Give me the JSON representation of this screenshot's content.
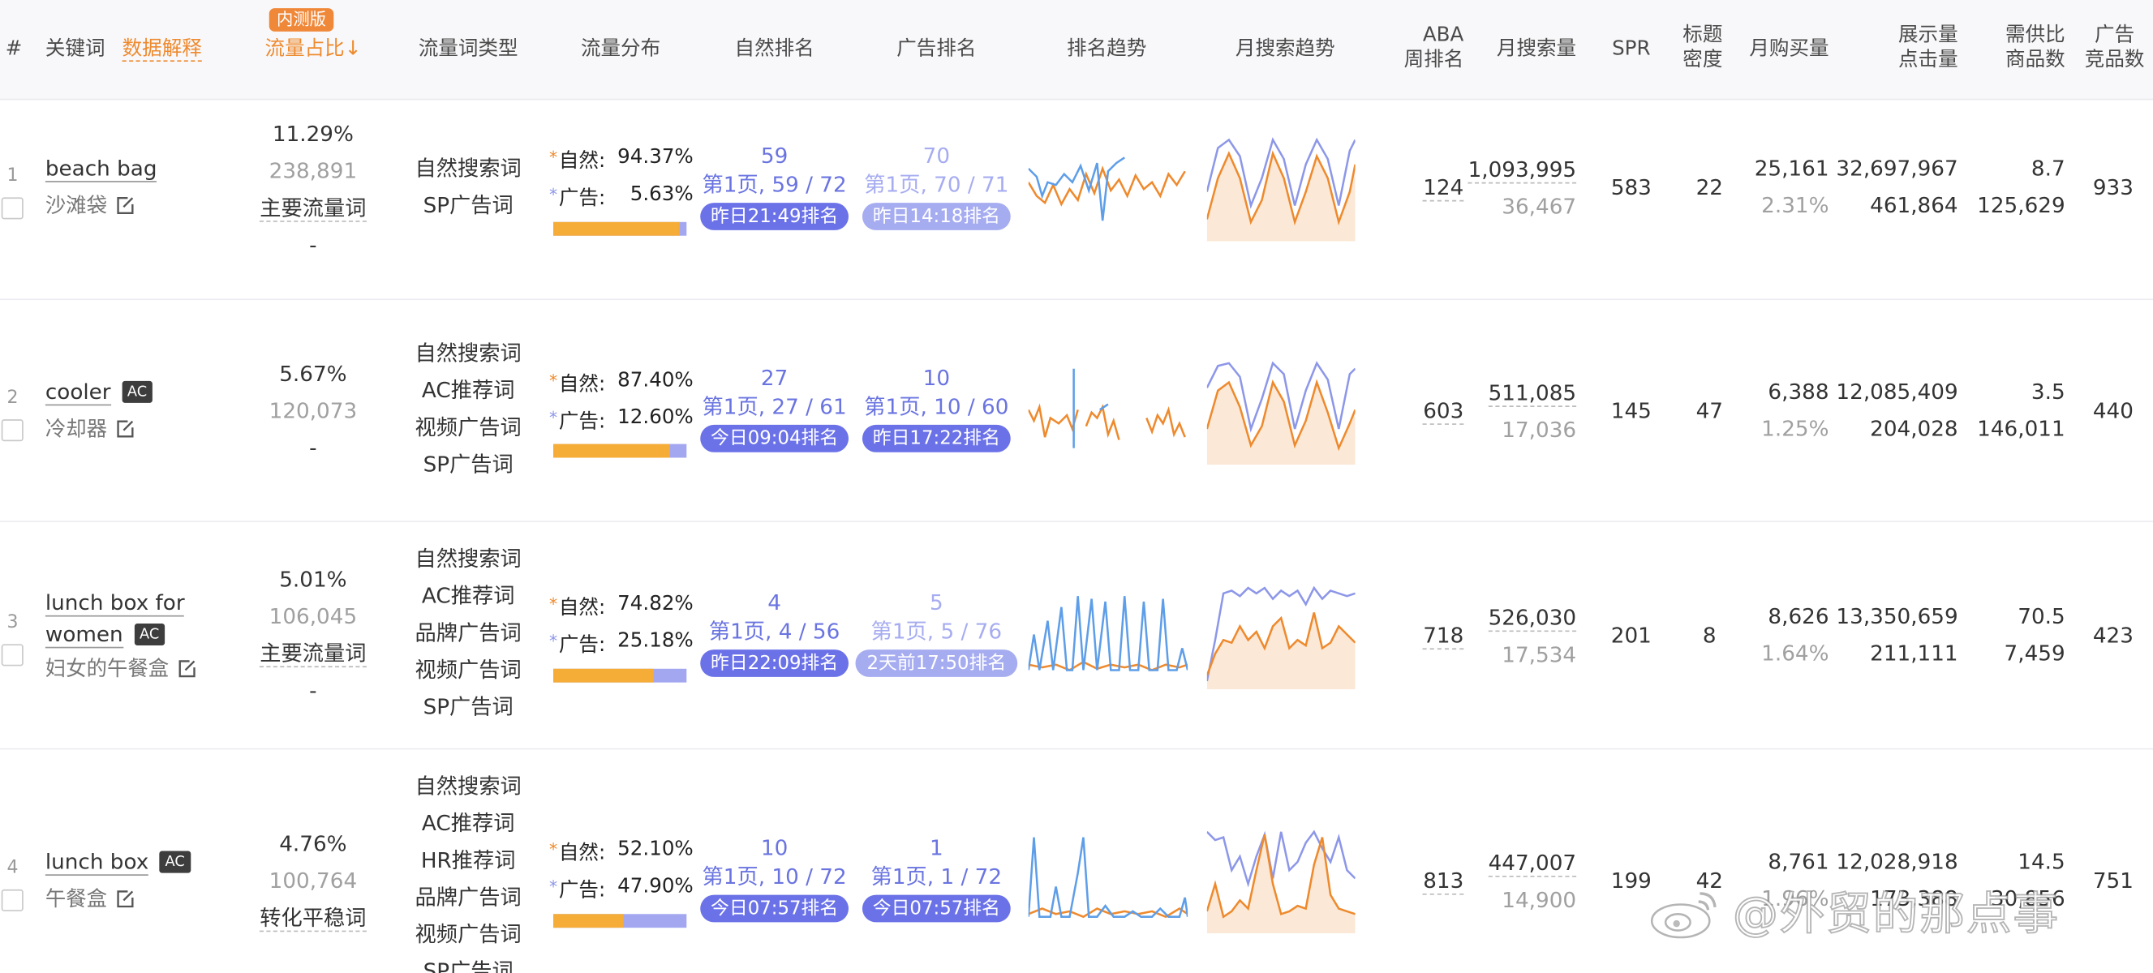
{
  "header": {
    "index": "#",
    "keyword": "关键词",
    "data_explain": "数据解释",
    "beta_badge": "内测版",
    "traffic_share": "流量占比↓",
    "traffic_type": "流量词类型",
    "traffic_dist": "流量分布",
    "organic_rank": "自然排名",
    "ad_rank": "广告排名",
    "rank_trend": "排名趋势",
    "monthly_trend": "月搜索趋势",
    "aba_1": "ABA",
    "aba_2": "周排名",
    "monthly_search": "月搜索量",
    "spr": "SPR",
    "title_density_1": "标题",
    "title_density_2": "密度",
    "monthly_purchase": "月购买量",
    "impressions_1": "展示量",
    "impressions_2": "点击量",
    "supply_1": "需供比",
    "supply_2": "商品数",
    "ad_comp_1": "广告",
    "ad_comp_2": "竞品数"
  },
  "rows": [
    {
      "index": "1",
      "keyword": "beach bag",
      "ac": "",
      "keyword_cn": "沙滩袋",
      "share": "11.29%",
      "share_sub": "238,891",
      "share_label": "主要流量词",
      "share_dash": "-",
      "types": [
        "自然搜索词",
        "SP广告词"
      ],
      "organic_label": "自然:",
      "organic_pct": "94.37%",
      "ad_label": "广告:",
      "ad_pct": "5.63%",
      "organic_fraction": 0.9437,
      "org_rank": "59",
      "org_page": "第1页, 59 / 72",
      "org_time": "昨日21:49排名",
      "ad_rank": "70",
      "ad_page": "第1页, 70 / 71",
      "ad_time": "昨日14:18排名",
      "aba": "124",
      "search": "1,093,995",
      "search_sub": "36,467",
      "spr": "583",
      "density": "22",
      "purchase": "25,161",
      "purchase_rate": "2.31%",
      "impressions": "32,697,967",
      "clicks": "461,864",
      "supply_ratio": "8.7",
      "products": "125,629",
      "ad_comp": "933"
    },
    {
      "index": "2",
      "keyword": "cooler",
      "ac": "AC",
      "keyword_cn": "冷却器",
      "share": "5.67%",
      "share_sub": "120,073",
      "share_label": "",
      "share_dash": "-",
      "types": [
        "自然搜索词",
        "AC推荐词",
        "视频广告词",
        "SP广告词"
      ],
      "organic_label": "自然:",
      "organic_pct": "87.40%",
      "ad_label": "广告:",
      "ad_pct": "12.60%",
      "organic_fraction": 0.874,
      "org_rank": "27",
      "org_page": "第1页, 27 / 61",
      "org_time": "今日09:04排名",
      "ad_rank": "10",
      "ad_page": "第1页, 10 / 60",
      "ad_time": "昨日17:22排名",
      "aba": "603",
      "search": "511,085",
      "search_sub": "17,036",
      "spr": "145",
      "density": "47",
      "purchase": "6,388",
      "purchase_rate": "1.25%",
      "impressions": "12,085,409",
      "clicks": "204,028",
      "supply_ratio": "3.5",
      "products": "146,011",
      "ad_comp": "440"
    },
    {
      "index": "3",
      "keyword": "lunch box for",
      "keyword2": "women",
      "ac": "AC",
      "keyword_cn": "妇女的午餐盒",
      "share": "5.01%",
      "share_sub": "106,045",
      "share_label": "主要流量词",
      "share_dash": "-",
      "types": [
        "自然搜索词",
        "AC推荐词",
        "品牌广告词",
        "视频广告词",
        "SP广告词"
      ],
      "organic_label": "自然:",
      "organic_pct": "74.82%",
      "ad_label": "广告:",
      "ad_pct": "25.18%",
      "organic_fraction": 0.7482,
      "org_rank": "4",
      "org_page": "第1页, 4 / 56",
      "org_time": "昨日22:09排名",
      "ad_rank": "5",
      "ad_page": "第1页, 5 / 76",
      "ad_time": "2天前17:50排名",
      "aba": "718",
      "search": "526,030",
      "search_sub": "17,534",
      "spr": "201",
      "density": "8",
      "purchase": "8,626",
      "purchase_rate": "1.64%",
      "impressions": "13,350,659",
      "clicks": "211,111",
      "supply_ratio": "70.5",
      "products": "7,459",
      "ad_comp": "423"
    },
    {
      "index": "4",
      "keyword": "lunch box",
      "ac": "AC",
      "keyword_cn": "午餐盒",
      "share": "4.76%",
      "share_sub": "100,764",
      "share_label": "转化平稳词",
      "share_dash": "",
      "types": [
        "自然搜索词",
        "AC推荐词",
        "HR推荐词",
        "品牌广告词",
        "视频广告词",
        "SP广告词"
      ],
      "organic_label": "自然:",
      "organic_pct": "52.10%",
      "ad_label": "广告:",
      "ad_pct": "47.90%",
      "organic_fraction": 0.521,
      "org_rank": "10",
      "org_page": "第1页, 10 / 72",
      "org_time": "今日07:57排名",
      "ad_rank": "1",
      "ad_page": "第1页, 1 / 72",
      "ad_time": "今日07:57排名",
      "aba": "813",
      "search": "447,007",
      "search_sub": "14,900",
      "spr": "199",
      "density": "42",
      "purchase": "8,761",
      "purchase_rate": "1.96%",
      "impressions": "12,028,918",
      "clicks": "173,388",
      "supply_ratio": "14.5",
      "products": "30,856",
      "ad_comp": "751"
    }
  ],
  "watermark": "@外贸的那点事",
  "colors": {
    "organic": "#f5ad37",
    "ad": "#a3a7ef",
    "rank_blue": "#6b72e8",
    "accent_orange": "#ee8a2e"
  }
}
